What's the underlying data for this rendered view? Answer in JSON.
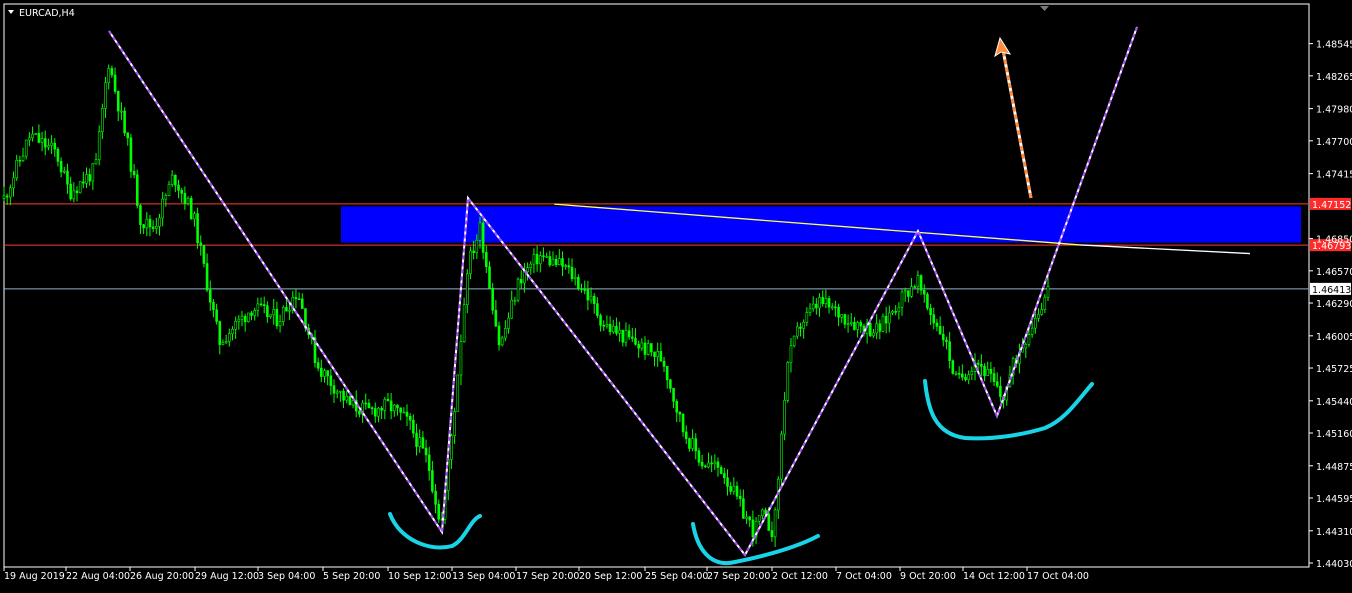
{
  "window": {
    "title": "EURCAD,H4"
  },
  "colors": {
    "background": "#000000",
    "frame": "#ffffff",
    "candle": "#00ff00",
    "zone": "#0000ff",
    "resistance": "#ff3b30",
    "bid_line": "#8fb3c9",
    "trendline": "#ffff66",
    "trendline_tail": "#ffffff",
    "zigzag": "#a64dff",
    "arrow": "#ff8c3a",
    "markup": "#19d3e6",
    "price_tag_red": "#ff2a2a",
    "price_tag_white": "#ffffff"
  },
  "chart_data": {
    "type": "candlestick",
    "symbol": "EURCAD",
    "timeframe": "H4",
    "title": "EURCAD,H4",
    "ylim": [
      1.4403,
      1.4862
    ],
    "y_ticks": [
      "1.48545",
      "1.48265",
      "1.47980",
      "1.47700",
      "1.47415",
      "1.46850",
      "1.46570",
      "1.46290",
      "1.46005",
      "1.45725",
      "1.45440",
      "1.45160",
      "1.44875",
      "1.44595",
      "1.44310",
      "1.44030"
    ],
    "x_tick_labels": [
      "19 Aug 2019",
      "22 Aug 04:00",
      "26 Aug 20:00",
      "29 Aug 12:00",
      "3 Sep 04:00",
      "5 Sep 20:00",
      "10 Sep 12:00",
      "13 Sep 04:00",
      "17 Sep 20:00",
      "20 Sep 12:00",
      "25 Sep 04:00",
      "27 Sep 20:00",
      "2 Oct 12:00",
      "7 Oct 04:00",
      "9 Oct 20:00",
      "14 Oct 12:00",
      "17 Oct 04:00"
    ],
    "price_anchors": [
      [
        0,
        1.472
      ],
      [
        0.02,
        1.4775
      ],
      [
        0.04,
        1.476
      ],
      [
        0.05,
        1.4725
      ],
      [
        0.07,
        1.4745
      ],
      [
        0.08,
        1.484
      ],
      [
        0.095,
        1.4765
      ],
      [
        0.105,
        1.47
      ],
      [
        0.115,
        1.4695
      ],
      [
        0.13,
        1.474
      ],
      [
        0.145,
        1.4705
      ],
      [
        0.165,
        1.4595
      ],
      [
        0.19,
        1.4625
      ],
      [
        0.21,
        1.4615
      ],
      [
        0.225,
        1.464
      ],
      [
        0.24,
        1.4575
      ],
      [
        0.265,
        1.454
      ],
      [
        0.28,
        1.4535
      ],
      [
        0.295,
        1.454
      ],
      [
        0.31,
        1.4525
      ],
      [
        0.325,
        1.449
      ],
      [
        0.335,
        1.4435
      ],
      [
        0.345,
        1.4535
      ],
      [
        0.355,
        1.466
      ],
      [
        0.365,
        1.4695
      ],
      [
        0.38,
        1.459
      ],
      [
        0.395,
        1.465
      ],
      [
        0.41,
        1.467
      ],
      [
        0.43,
        1.466
      ],
      [
        0.445,
        1.464
      ],
      [
        0.46,
        1.461
      ],
      [
        0.475,
        1.46
      ],
      [
        0.49,
        1.459
      ],
      [
        0.505,
        1.458
      ],
      [
        0.52,
        1.452
      ],
      [
        0.535,
        1.449
      ],
      [
        0.55,
        1.4485
      ],
      [
        0.565,
        1.445
      ],
      [
        0.575,
        1.443
      ],
      [
        0.58,
        1.4445
      ],
      [
        0.59,
        1.443
      ],
      [
        0.6,
        1.4575
      ],
      [
        0.61,
        1.461
      ],
      [
        0.625,
        1.463
      ],
      [
        0.64,
        1.462
      ],
      [
        0.655,
        1.461
      ],
      [
        0.67,
        1.4605
      ],
      [
        0.685,
        1.463
      ],
      [
        0.7,
        1.465
      ],
      [
        0.705,
        1.463
      ],
      [
        0.72,
        1.46
      ],
      [
        0.73,
        1.456
      ],
      [
        0.745,
        1.458
      ],
      [
        0.755,
        1.4565
      ],
      [
        0.765,
        1.4545
      ],
      [
        0.775,
        1.458
      ],
      [
        0.785,
        1.4605
      ],
      [
        0.8,
        1.464
      ]
    ],
    "levels": {
      "resistance_high": {
        "price": 1.47152,
        "label": "1.47152"
      },
      "resistance_low": {
        "price": 1.46793,
        "label": "1.46793"
      },
      "bid": {
        "price": 1.46413,
        "label": "1.46413"
      }
    },
    "zone": {
      "type": "supply_zone",
      "price_high": 1.4713,
      "price_low": 1.46815,
      "x_start": "5 Sep 20:00",
      "x_end_frac": 1.0
    },
    "trendline": {
      "points": [
        {
          "x_frac": 0.345,
          "price": 1.4715
        },
        {
          "x_frac": 0.81,
          "price": 1.46795
        },
        {
          "x_frac": 0.955,
          "price": 1.4672
        }
      ]
    },
    "zigzag": [
      {
        "x_frac": 0.083,
        "price": 1.4855
      },
      {
        "x_frac": 0.338,
        "price": 1.4427
      },
      {
        "x_frac": 0.36,
        "price": 1.4713
      },
      {
        "x_frac": 0.57,
        "price": 1.4414
      },
      {
        "x_frac": 0.703,
        "price": 1.4685
      },
      {
        "x_frac": 0.762,
        "price": 1.4533
      },
      {
        "x_frac": 0.868,
        "price": 1.486
      }
    ],
    "arrow": {
      "from": {
        "x_frac": 0.788,
        "price": 1.4715
      },
      "to": {
        "x_frac": 0.765,
        "price": 1.484
      }
    },
    "curves": [
      {
        "name": "curve-1",
        "points": [
          [
            0.297,
            1.4445
          ],
          [
            0.31,
            1.443
          ],
          [
            0.34,
            1.4424
          ],
          [
            0.365,
            1.4445
          ]
        ]
      },
      {
        "name": "curve-2",
        "points": [
          [
            0.529,
            1.443
          ],
          [
            0.545,
            1.4404
          ],
          [
            0.59,
            1.441
          ],
          [
            0.624,
            1.4424
          ]
        ]
      },
      {
        "name": "curve-3",
        "points": [
          [
            0.707,
            1.4567
          ],
          [
            0.72,
            1.4515
          ],
          [
            0.76,
            1.4514
          ],
          [
            0.795,
            1.452
          ],
          [
            0.83,
            1.456
          ]
        ]
      }
    ],
    "bar_count": 330
  }
}
